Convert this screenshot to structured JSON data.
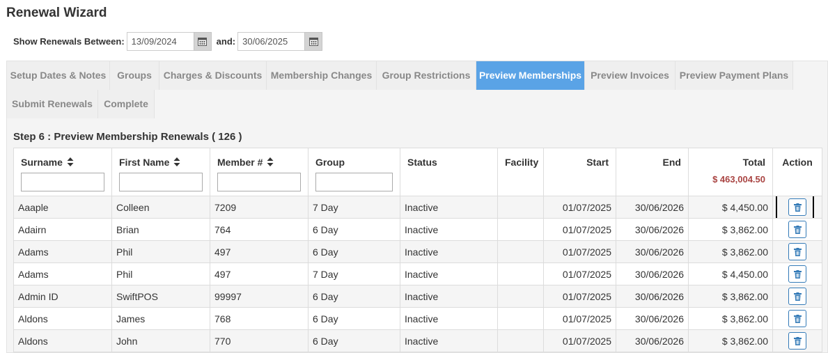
{
  "page": {
    "title": "Renewal Wizard"
  },
  "filters": {
    "show_between_label": "Show Renewals Between:",
    "start_date": "13/09/2024",
    "and_label": "and:",
    "end_date": "30/06/2025"
  },
  "tabs": [
    {
      "label": "Setup Dates & Notes",
      "active": false
    },
    {
      "label": "Groups",
      "active": false
    },
    {
      "label": "Charges & Discounts",
      "active": false
    },
    {
      "label": "Membership Changes",
      "active": false
    },
    {
      "label": "Group Restrictions",
      "active": false
    },
    {
      "label": "Preview Memberships",
      "active": true
    },
    {
      "label": "Preview Invoices",
      "active": false
    },
    {
      "label": "Preview Payment Plans",
      "active": false
    },
    {
      "label": "Submit Renewals",
      "active": false
    },
    {
      "label": "Complete",
      "active": false
    }
  ],
  "step": {
    "title": "Step 6 : Preview Membership Renewals ( 126 )"
  },
  "table": {
    "columns": {
      "surname": "Surname",
      "first_name": "First Name",
      "member_no": "Member #",
      "group": "Group",
      "status": "Status",
      "facility": "Facility",
      "start": "Start",
      "end": "End",
      "total": "Total",
      "action": "Action"
    },
    "total_sum": "$ 463,004.50",
    "rows": [
      {
        "surname": "Aaaple",
        "first_name": "Colleen",
        "member_no": "7209",
        "group": "7 Day",
        "status": "Inactive",
        "facility": "",
        "start": "01/07/2025",
        "end": "30/06/2026",
        "total": "$ 4,450.00"
      },
      {
        "surname": "Adairn",
        "first_name": "Brian",
        "member_no": "764",
        "group": "6 Day",
        "status": "Inactive",
        "facility": "",
        "start": "01/07/2025",
        "end": "30/06/2026",
        "total": "$ 3,862.00"
      },
      {
        "surname": "Adams",
        "first_name": "Phil",
        "member_no": "497",
        "group": "6 Day",
        "status": "Inactive",
        "facility": "",
        "start": "01/07/2025",
        "end": "30/06/2026",
        "total": "$ 3,862.00"
      },
      {
        "surname": "Adams",
        "first_name": "Phil",
        "member_no": "497",
        "group": "7 Day",
        "status": "Inactive",
        "facility": "",
        "start": "01/07/2025",
        "end": "30/06/2026",
        "total": "$ 4,450.00"
      },
      {
        "surname": "Admin ID",
        "first_name": "SwiftPOS",
        "member_no": "99997",
        "group": "6 Day",
        "status": "Inactive",
        "facility": "",
        "start": "01/07/2025",
        "end": "30/06/2026",
        "total": "$ 3,862.00"
      },
      {
        "surname": "Aldons",
        "first_name": "James",
        "member_no": "768",
        "group": "6 Day",
        "status": "Inactive",
        "facility": "",
        "start": "01/07/2025",
        "end": "30/06/2026",
        "total": "$ 3,862.00"
      },
      {
        "surname": "Aldons",
        "first_name": "John",
        "member_no": "770",
        "group": "6 Day",
        "status": "Inactive",
        "facility": "",
        "start": "01/07/2025",
        "end": "30/06/2026",
        "total": "$ 3,862.00"
      }
    ]
  },
  "icons": {
    "calendar": "calendar-icon",
    "sort": "sort-icon",
    "delete": "trash-icon"
  },
  "colors": {
    "active_tab": "#5aa3e6",
    "link": "#337ab7",
    "total_sum": "#a94442"
  }
}
